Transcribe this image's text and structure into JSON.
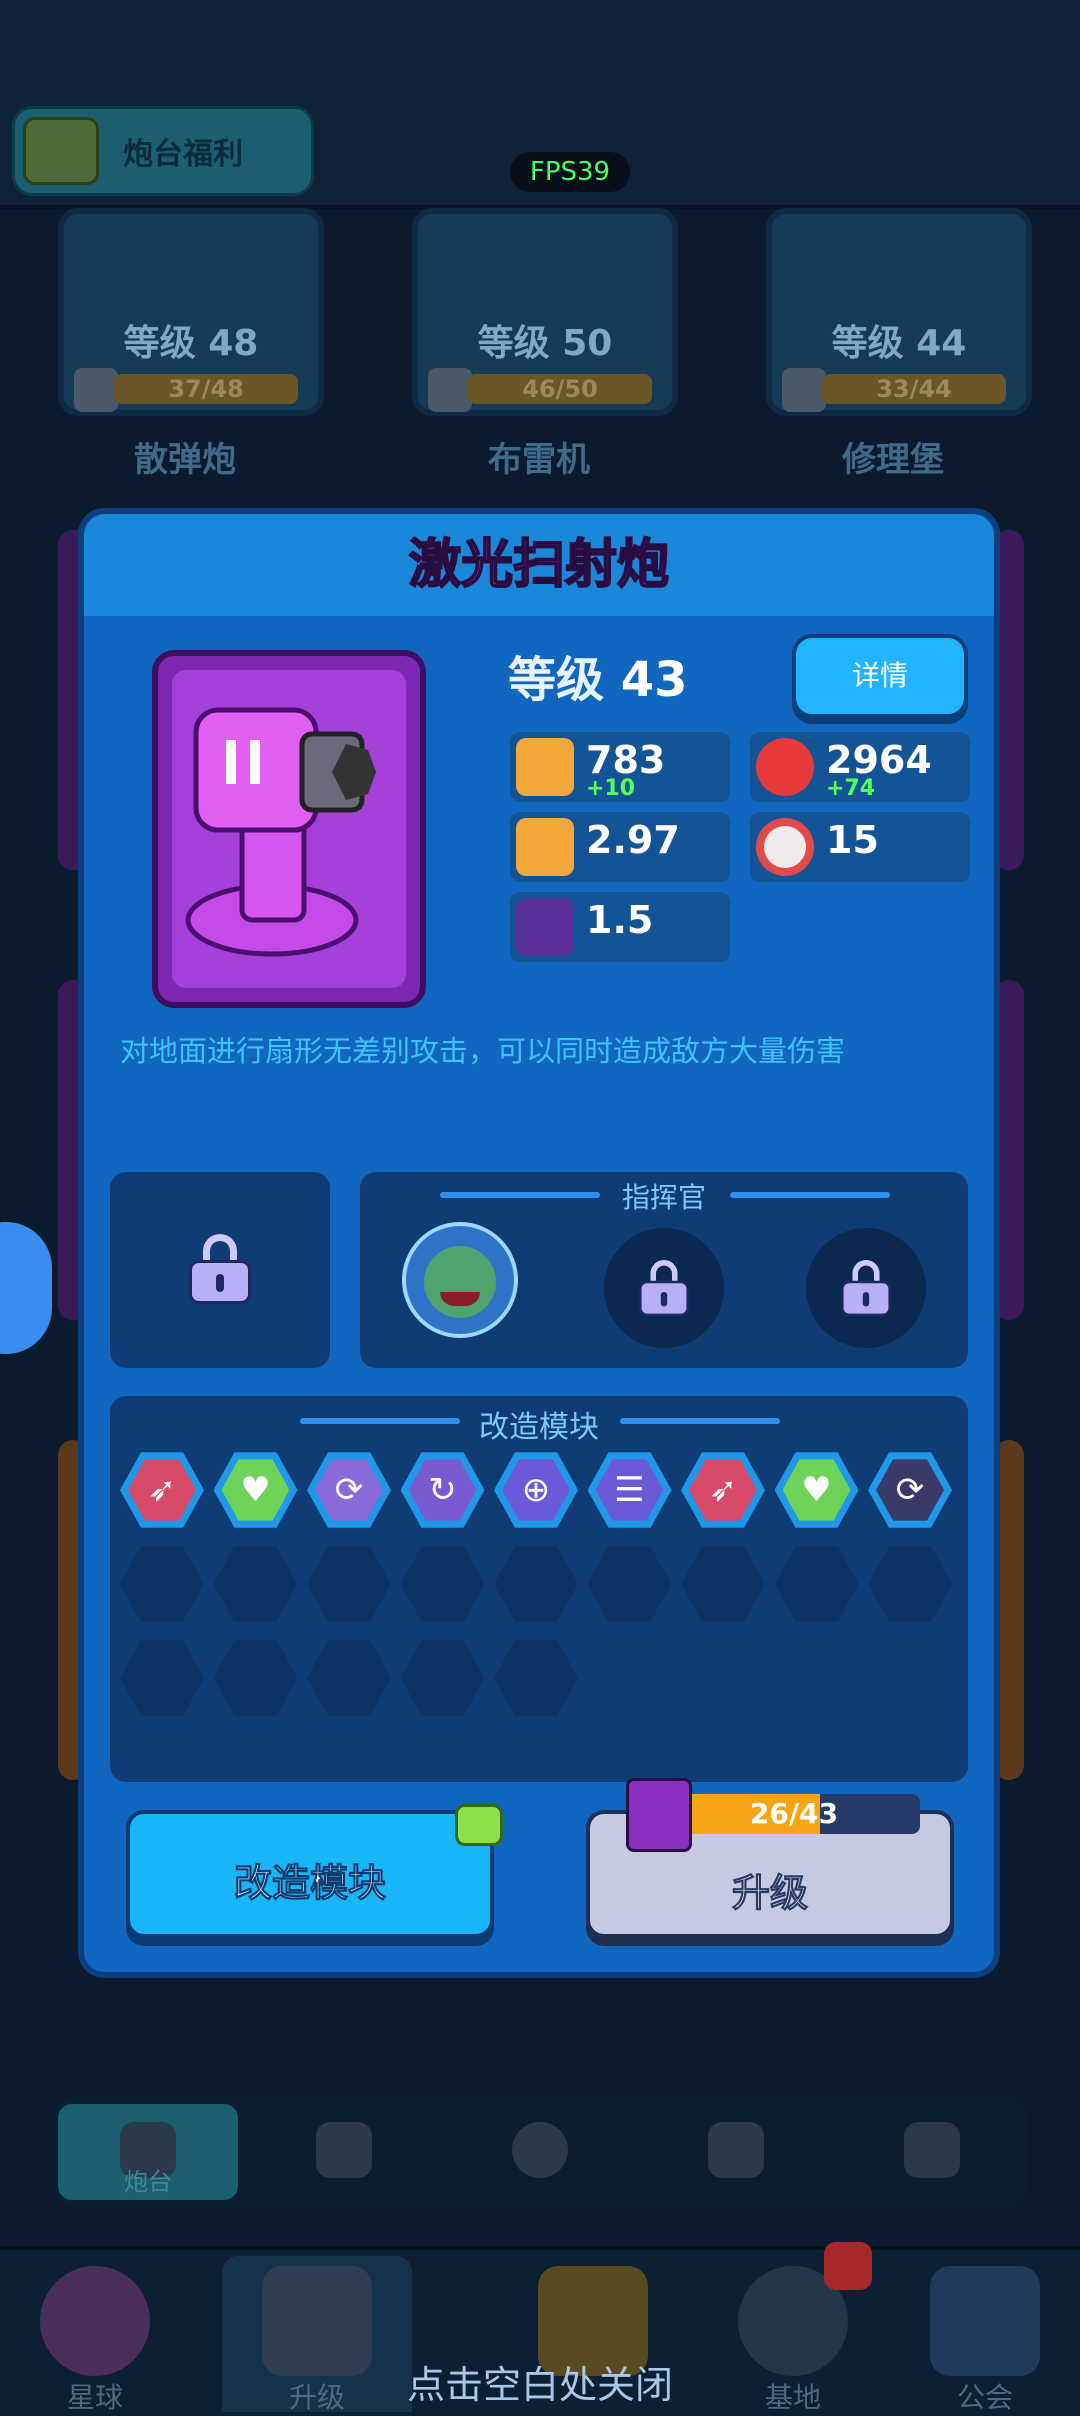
{
  "top": {
    "welfare_label": "炮台福利",
    "fps": "FPS39"
  },
  "background_cards": [
    {
      "level_prefix": "等级",
      "level": "48",
      "progress": "37/48",
      "name": "散弹炮"
    },
    {
      "level_prefix": "等级",
      "level": "50",
      "progress": "46/50",
      "name": "布雷机"
    },
    {
      "level_prefix": "等级",
      "level": "44",
      "progress": "33/44",
      "name": "修理堡"
    }
  ],
  "modal": {
    "title": "激光扫射炮",
    "level_prefix": "等级",
    "level": "43",
    "detail_button": "详情",
    "stats": [
      {
        "icon": "bullet-damage-icon",
        "value": "783",
        "bonus": "+10"
      },
      {
        "icon": "heart-icon",
        "value": "2964",
        "bonus": "+74"
      },
      {
        "icon": "fire-rate-icon",
        "value": "2.97",
        "bonus": ""
      },
      {
        "icon": "target-icon",
        "value": "15",
        "bonus": ""
      },
      {
        "icon": "ammo-clip-icon",
        "value": "1.5",
        "bonus": ""
      }
    ],
    "description": "对地面进行扇形无差别攻击，可以同时造成敌方大量伤害",
    "commander_title": "指挥官",
    "module_title": "改造模块",
    "modules": [
      {
        "icon": "rocket-icon",
        "glyph": "➶",
        "color": "#d84a6a"
      },
      {
        "icon": "heart-module-icon",
        "glyph": "♥",
        "color": "#6fd35a"
      },
      {
        "icon": "cycle-icon",
        "glyph": "⟳",
        "color": "#8a6ad8"
      },
      {
        "icon": "reload-icon",
        "glyph": "↻",
        "color": "#7a5ad0"
      },
      {
        "icon": "crosshair-icon",
        "glyph": "⊕",
        "color": "#6a5ad8"
      },
      {
        "icon": "stack-icon",
        "glyph": "☰",
        "color": "#6a5ad8"
      },
      {
        "icon": "rocket-icon",
        "glyph": "➶",
        "color": "#d84a6a"
      },
      {
        "icon": "heart-module-icon",
        "glyph": "♥",
        "color": "#6fd35a"
      },
      {
        "icon": "cycle-icon-dim",
        "glyph": "⟳",
        "color": "#3a3a6a"
      }
    ],
    "empty_slots": 14,
    "modify_button": "改造模块",
    "upgrade_button": "升级",
    "upgrade_progress": "26/43",
    "upgrade_progress_ratio": 0.605
  },
  "subtabs": [
    {
      "icon": "turret-icon",
      "label": "炮台"
    },
    {
      "icon": "gear-star-icon",
      "label": ""
    },
    {
      "icon": "lightning-icon",
      "label": ""
    },
    {
      "icon": "helmet-icon",
      "label": ""
    },
    {
      "icon": "monster-icon",
      "label": ""
    }
  ],
  "nav": [
    {
      "icon": "planet-icon",
      "label": "星球"
    },
    {
      "icon": "hammer-wrench-icon",
      "label": "升级"
    },
    {
      "icon": "shield-icon",
      "label": ""
    },
    {
      "icon": "base-icon",
      "label": "基地"
    },
    {
      "icon": "guild-icon",
      "label": "公会"
    }
  ],
  "close_hint": "点击空白处关闭"
}
